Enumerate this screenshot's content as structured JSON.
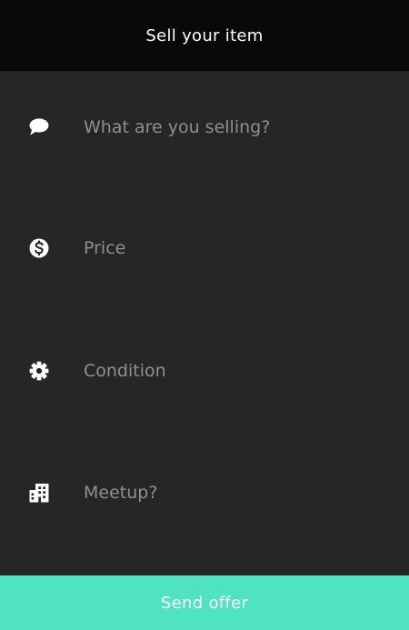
{
  "header": {
    "title": "Sell your item",
    "background": "#090909"
  },
  "form": {
    "fields": [
      {
        "name": "item",
        "icon": "chat-bubble-icon",
        "placeholder": "What are you selling?",
        "value": ""
      },
      {
        "name": "price",
        "icon": "dollar-circle-icon",
        "placeholder": "Price",
        "value": ""
      },
      {
        "name": "condition",
        "icon": "gear-icon",
        "placeholder": "Condition",
        "value": ""
      },
      {
        "name": "meetup",
        "icon": "building-icon",
        "placeholder": "Meetup?",
        "value": ""
      }
    ]
  },
  "submit": {
    "label": "Send offer",
    "color": "#50e3c2"
  },
  "theme": {
    "background": "#262626",
    "placeholder_color": "#8f8f8f",
    "text_color": "#ffffff"
  }
}
